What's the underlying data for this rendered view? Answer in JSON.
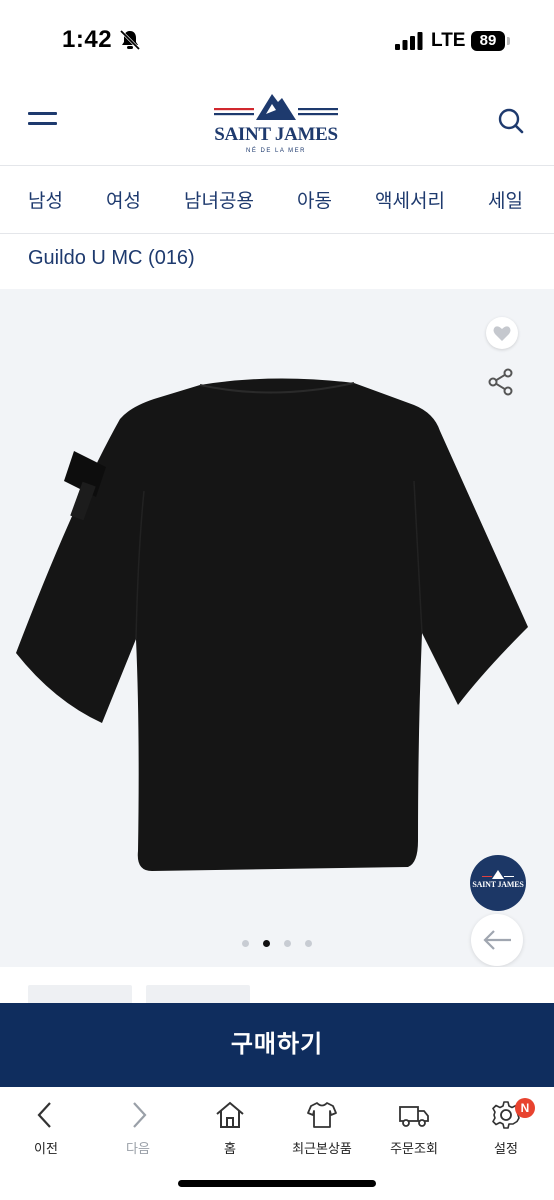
{
  "status_bar": {
    "time": "1:42",
    "network": "LTE",
    "battery": "89"
  },
  "header": {
    "brand_name": "SAINT JAMES",
    "brand_tagline": "NÉ DE LA MER"
  },
  "category_nav": {
    "items": [
      "남성",
      "여성",
      "남녀공용",
      "아동",
      "액세서리",
      "세일"
    ]
  },
  "product": {
    "title": "Guildo U MC (016)"
  },
  "gallery": {
    "slide_count": 4,
    "active_slide": 2,
    "badge_text": "SAINT JAMES"
  },
  "buy_button": {
    "label": "구매하기"
  },
  "toolbar": {
    "items": [
      {
        "label": "이전",
        "icon": "chevron-left-icon"
      },
      {
        "label": "다음",
        "icon": "chevron-right-icon"
      },
      {
        "label": "홈",
        "icon": "home-icon"
      },
      {
        "label": "최근본상품",
        "icon": "tshirt-icon"
      },
      {
        "label": "주문조회",
        "icon": "truck-icon"
      },
      {
        "label": "설정",
        "icon": "gear-icon"
      }
    ],
    "settings_badge": "N"
  },
  "colors": {
    "brand_navy": "#0f2d5e",
    "nav_text": "#1e3a6e",
    "accent_red": "#e8432f"
  }
}
